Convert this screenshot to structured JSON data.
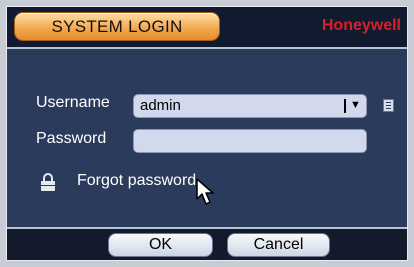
{
  "title": "SYSTEM LOGIN",
  "brand": "Honeywell",
  "username": {
    "label": "Username",
    "value": "admin"
  },
  "password": {
    "label": "Password",
    "value": ""
  },
  "forgot": {
    "label": "Forgot password"
  },
  "buttons": {
    "ok": "OK",
    "cancel": "Cancel"
  },
  "icons": {
    "keyboard": "keyboard-icon",
    "lock": "lock-icon",
    "dropdown": "chevron-down-icon",
    "cursor": "mouse-pointer-icon"
  },
  "colors": {
    "title_tab": "#f4a952",
    "brand": "#d8202a",
    "background": "#2a3b5c",
    "field": "#d3d9ec"
  }
}
